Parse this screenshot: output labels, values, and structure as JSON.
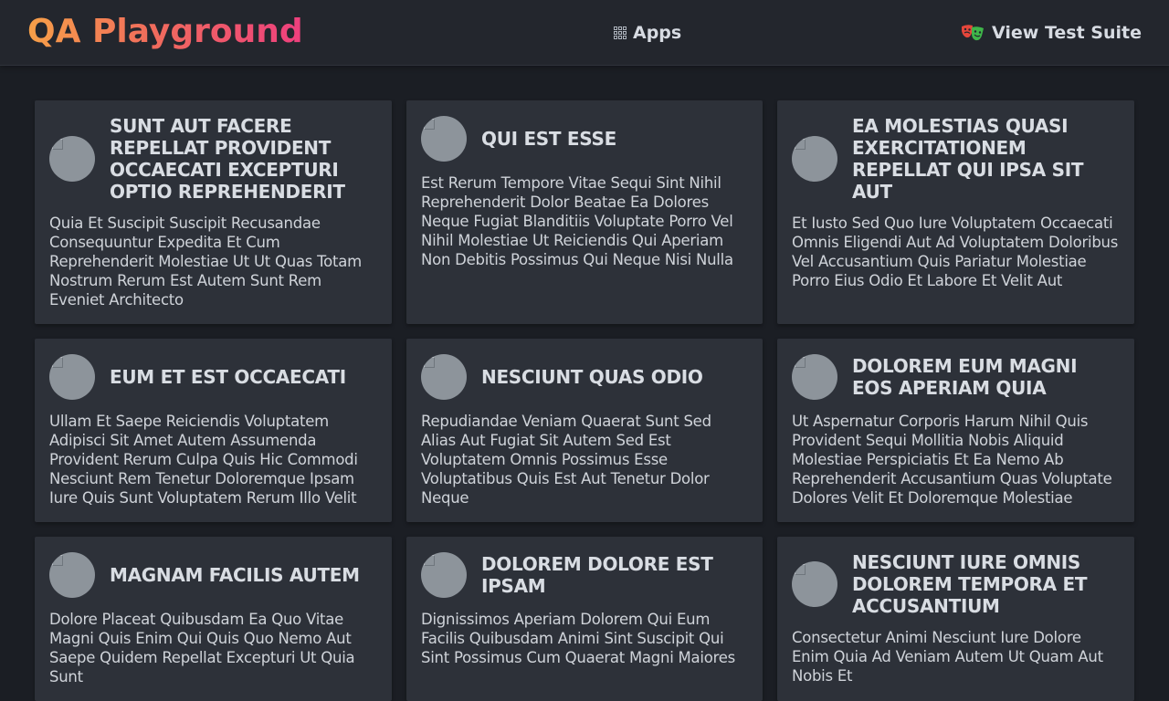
{
  "navbar": {
    "brand": "QA Playground",
    "apps_label": "Apps",
    "suite_label": "View Test Suite",
    "suite_icon": "theater-masks-icon",
    "apps_icon": "grid-icon"
  },
  "posts": [
    {
      "title": "sunt aut facere repellat provident occaecati excepturi optio reprehenderit",
      "body": "Quia Et Suscipit Suscipit Recusandae Consequuntur Expedita Et Cum Reprehenderit Molestiae Ut Ut Quas Totam Nostrum Rerum Est Autem Sunt Rem Eveniet Architecto"
    },
    {
      "title": "qui est esse",
      "body": "Est Rerum Tempore Vitae Sequi Sint Nihil Reprehenderit Dolor Beatae Ea Dolores Neque Fugiat Blanditiis Voluptate Porro Vel Nihil Molestiae Ut Reiciendis Qui Aperiam Non Debitis Possimus Qui Neque Nisi Nulla"
    },
    {
      "title": "ea molestias quasi exercitationem repellat qui ipsa sit aut",
      "body": "Et Iusto Sed Quo Iure Voluptatem Occaecati Omnis Eligendi Aut Ad Voluptatem Doloribus Vel Accusantium Quis Pariatur Molestiae Porro Eius Odio Et Labore Et Velit Aut"
    },
    {
      "title": "eum et est occaecati",
      "body": "Ullam Et Saepe Reiciendis Voluptatem Adipisci Sit Amet Autem Assumenda Provident Rerum Culpa Quis Hic Commodi Nesciunt Rem Tenetur Doloremque Ipsam Iure Quis Sunt Voluptatem Rerum Illo Velit"
    },
    {
      "title": "nesciunt quas odio",
      "body": "Repudiandae Veniam Quaerat Sunt Sed Alias Aut Fugiat Sit Autem Sed Est Voluptatem Omnis Possimus Esse Voluptatibus Quis Est Aut Tenetur Dolor Neque"
    },
    {
      "title": "dolorem eum magni eos aperiam quia",
      "body": "Ut Aspernatur Corporis Harum Nihil Quis Provident Sequi Mollitia Nobis Aliquid Molestiae Perspiciatis Et Ea Nemo Ab Reprehenderit Accusantium Quas Voluptate Dolores Velit Et Doloremque Molestiae"
    },
    {
      "title": "magnam facilis autem",
      "body": "Dolore Placeat Quibusdam Ea Quo Vitae Magni Quis Enim Qui Quis Quo Nemo Aut Saepe Quidem Repellat Excepturi Ut Quia Sunt"
    },
    {
      "title": "dolorem dolore est ipsam",
      "body": "Dignissimos Aperiam Dolorem Qui Eum Facilis Quibusdam Animi Sint Suscipit Qui Sint Possimus Cum Quaerat Magni Maiores"
    },
    {
      "title": "nesciunt iure omnis dolorem tempora et accusantium",
      "body": "Consectetur Animi Nesciunt Iure Dolore Enim Quia Ad Veniam Autem Ut Quam Aut Nobis Et"
    }
  ]
}
